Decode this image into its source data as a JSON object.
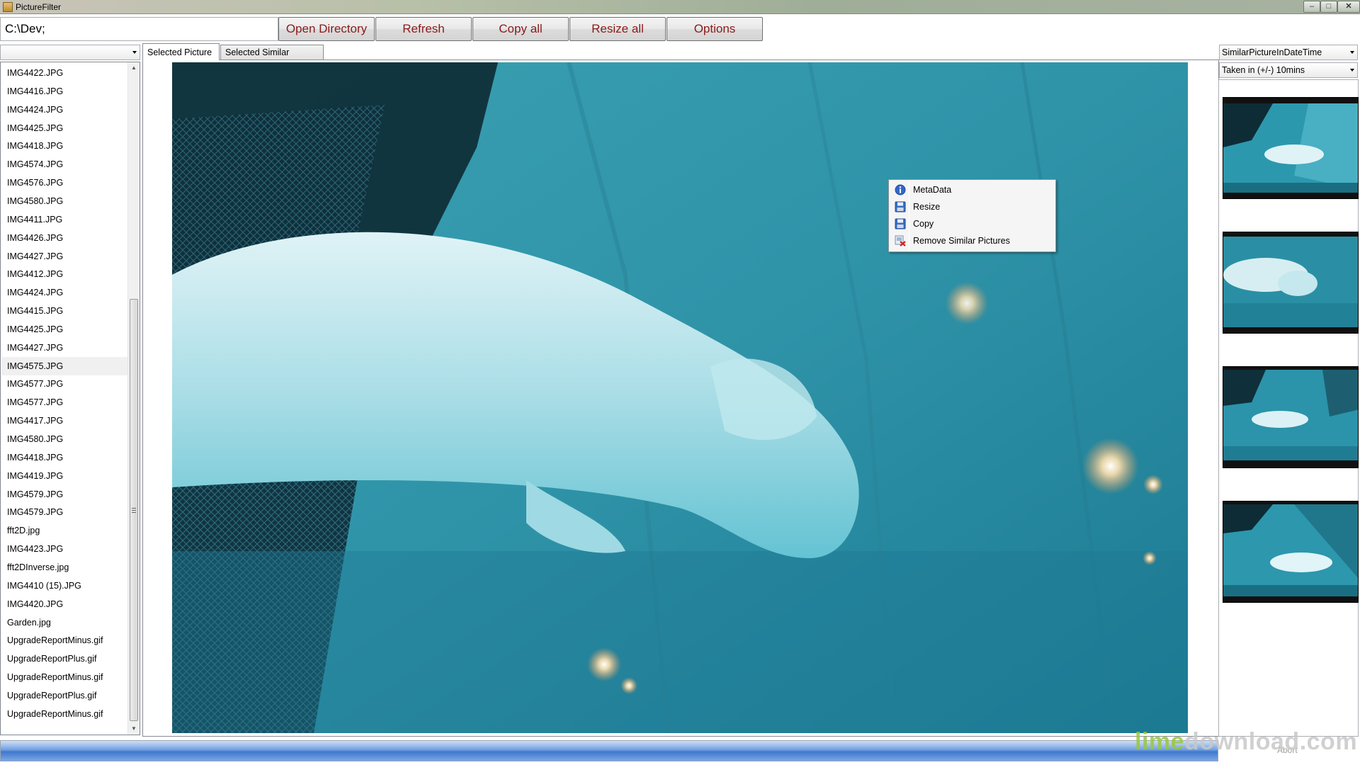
{
  "window": {
    "title": "PictureFilter"
  },
  "toolbar": {
    "path_value": "C:\\Dev;",
    "buttons": [
      "Open Directory",
      "Refresh",
      "Copy all",
      "Resize all",
      "Options"
    ]
  },
  "file_combo": {
    "selected": ""
  },
  "files": [
    "IMG4422.JPG",
    "IMG4416.JPG",
    "IMG4424.JPG",
    "IMG4425.JPG",
    "IMG4418.JPG",
    "IMG4574.JPG",
    "IMG4576.JPG",
    "IMG4580.JPG",
    "IMG4411.JPG",
    "IMG4426.JPG",
    "IMG4427.JPG",
    "IMG4412.JPG",
    "IMG4424.JPG",
    "IMG4415.JPG",
    "IMG4425.JPG",
    "IMG4427.JPG",
    "IMG4575.JPG",
    "IMG4577.JPG",
    "IMG4577.JPG",
    "IMG4417.JPG",
    "IMG4580.JPG",
    "IMG4418.JPG",
    "IMG4419.JPG",
    "IMG4579.JPG",
    "IMG4579.JPG",
    "fft2D.jpg",
    "IMG4423.JPG",
    "fft2DInverse.jpg",
    "IMG4410 (15).JPG",
    "IMG4420.JPG",
    "Garden.jpg",
    "UpgradeReportMinus.gif",
    "UpgradeReportPlus.gif",
    "UpgradeReportMinus.gif",
    "UpgradeReportPlus.gif",
    "UpgradeReportMinus.gif"
  ],
  "selected_file_index": 16,
  "tabs": {
    "selected_picture": "Selected Picture",
    "selected_similar_picture": "Selected Similar Picture"
  },
  "context_menu": {
    "items": [
      {
        "label": "MetaData",
        "icon": "info-icon"
      },
      {
        "label": "Resize",
        "icon": "save-icon"
      },
      {
        "label": "Copy",
        "icon": "save-icon"
      },
      {
        "label": "Remove Similar Pictures",
        "icon": "remove-icon"
      }
    ]
  },
  "right_panel": {
    "similarity_mode": "SimilarPictureInDateTime",
    "time_window": "Taken in (+/-) 10mins"
  },
  "status": {
    "progress_fraction": 1.0,
    "abort_label": "Abort"
  },
  "watermark": {
    "part1": "lime",
    "part2": "download.com"
  },
  "colors": {
    "button_text": "#8b1a1a",
    "water": "#2a8fa4",
    "progress": "#3f78cf"
  }
}
